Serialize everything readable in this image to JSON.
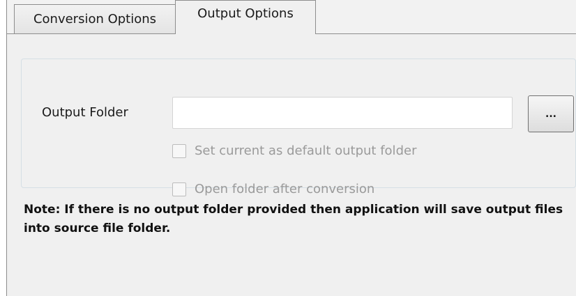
{
  "tabs": [
    {
      "label": "Conversion Options",
      "active": false
    },
    {
      "label": "Output Options",
      "active": true
    }
  ],
  "output": {
    "folder_label": "Output Folder",
    "folder_value": "",
    "browse_label": "...",
    "set_default_label": "Set current as default output folder",
    "set_default_checked": false,
    "open_after_label": "Open folder after conversion",
    "open_after_checked": false
  },
  "note": "Note: If there is no output folder provided then application will save output files into source file folder."
}
